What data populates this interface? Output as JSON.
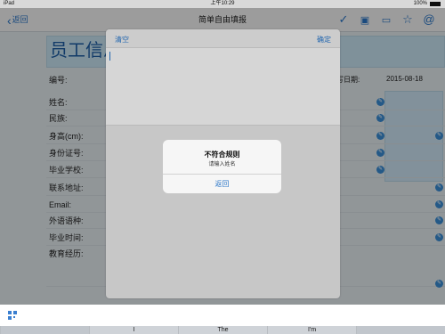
{
  "status_bar": {
    "device": "iPad",
    "time": "上午10:29",
    "battery": "100%"
  },
  "nav": {
    "back_label": "返回",
    "title": "简单自由填报",
    "icons": [
      "checkmark-icon",
      "save-icon",
      "list-icon",
      "star-icon",
      "at-icon"
    ]
  },
  "form": {
    "title": "员工信息",
    "number_label": "编号:",
    "fill_date_label": "写日期:",
    "fill_date": "2015-08-18",
    "fields": [
      "姓名:",
      "民族:",
      "身高(cm):",
      "身份证号:",
      "毕业学校:",
      "联系地址:",
      "Email:",
      "外语语种:",
      "毕业时间:",
      "教育经历:"
    ]
  },
  "popover": {
    "clear_label": "清空",
    "confirm_label": "确定"
  },
  "alert": {
    "title": "不符合规则",
    "message": "请输入姓名",
    "button": "返回"
  },
  "keyboard": {
    "suggestions": [
      "",
      "I",
      "The",
      "I'm",
      ""
    ]
  }
}
